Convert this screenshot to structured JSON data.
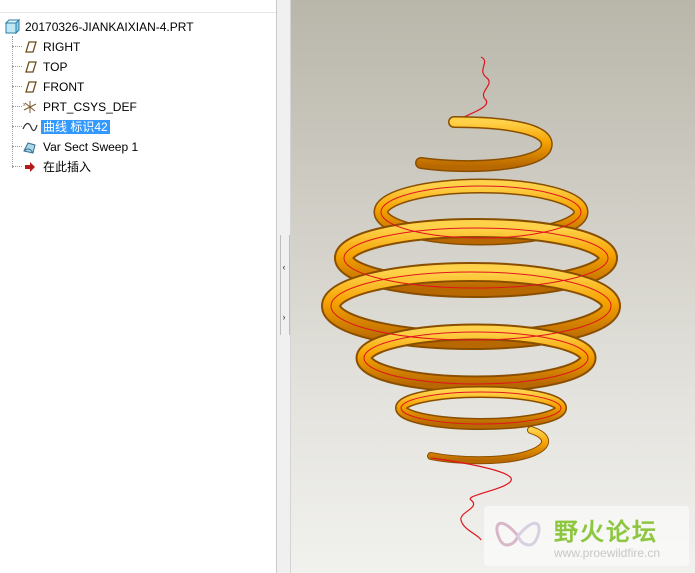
{
  "tree": {
    "root": "20170326-JIANKAIXIAN-4.PRT",
    "items": [
      {
        "label": "RIGHT",
        "icon": "datum-plane-icon"
      },
      {
        "label": "TOP",
        "icon": "datum-plane-icon"
      },
      {
        "label": "FRONT",
        "icon": "datum-plane-icon"
      },
      {
        "label": "PRT_CSYS_DEF",
        "icon": "coordinate-system-icon"
      },
      {
        "label": "曲线 标识42",
        "icon": "curve-icon",
        "selected": true
      },
      {
        "label": "Var Sect Sweep 1",
        "icon": "sweep-feature-icon"
      },
      {
        "label": "在此插入",
        "icon": "insert-here-arrow-icon"
      }
    ]
  },
  "splitter": {
    "collapse_arrow": "‹",
    "expand_arrow": "›"
  },
  "watermark": {
    "title": "野火论坛",
    "url": "www.proewildfire.cn"
  },
  "colors": {
    "selection": "#3399ff",
    "spring": "#f5a200",
    "curve": "#e0141e"
  }
}
